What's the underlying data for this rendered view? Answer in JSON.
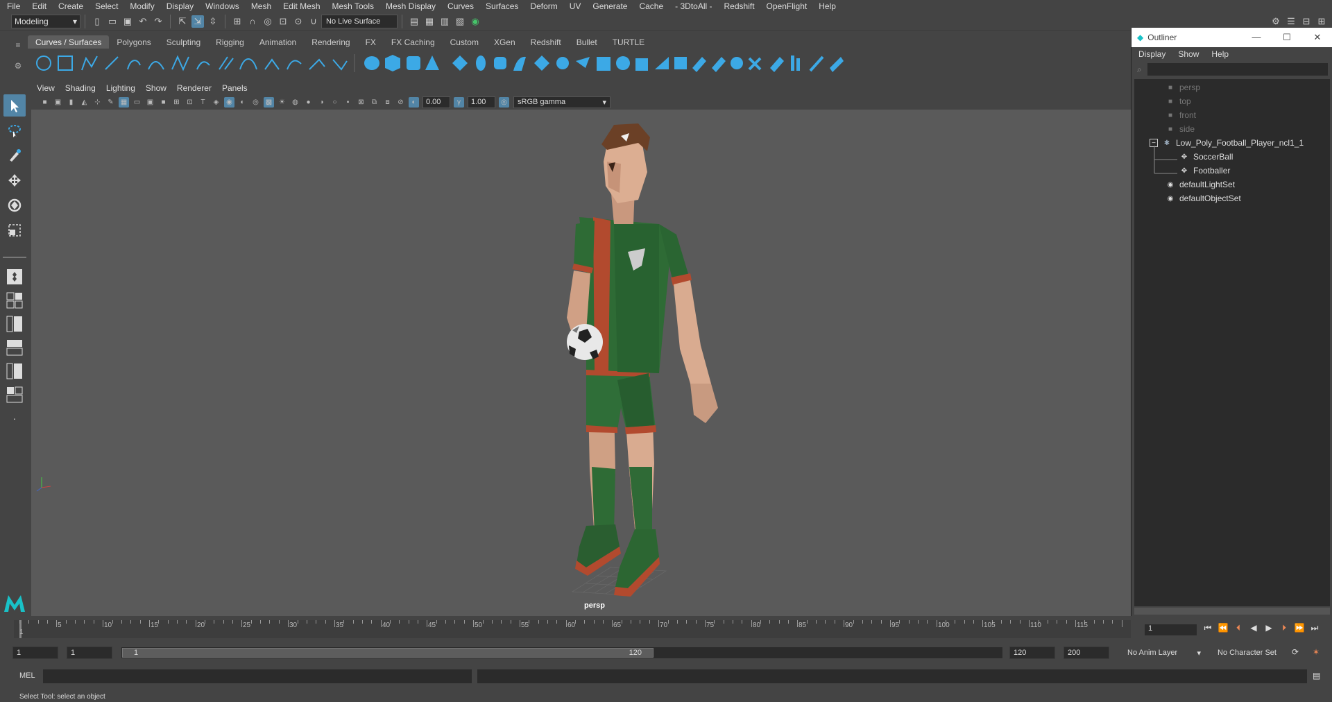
{
  "menubar": [
    "File",
    "Edit",
    "Create",
    "Select",
    "Modify",
    "Display",
    "Windows",
    "Mesh",
    "Edit Mesh",
    "Mesh Tools",
    "Mesh Display",
    "Curves",
    "Surfaces",
    "Deform",
    "UV",
    "Generate",
    "Cache",
    "- 3DtoAll -",
    "Redshift",
    "OpenFlight",
    "Help"
  ],
  "toolbar": {
    "mode": "Modeling",
    "live_surface": "No Live Surface"
  },
  "shelf_tabs": [
    "Curves / Surfaces",
    "Polygons",
    "Sculpting",
    "Rigging",
    "Animation",
    "Rendering",
    "FX",
    "FX Caching",
    "Custom",
    "XGen",
    "Redshift",
    "Bullet",
    "TURTLE"
  ],
  "panel_menu": [
    "View",
    "Shading",
    "Lighting",
    "Show",
    "Renderer",
    "Panels"
  ],
  "panel_tools": {
    "exposure": "0.00",
    "gamma": "1.00",
    "color_space": "sRGB gamma"
  },
  "viewport": {
    "camera": "persp"
  },
  "outliner": {
    "title": "Outliner",
    "menu": [
      "Display",
      "Show",
      "Help"
    ],
    "items": [
      {
        "label": "persp",
        "dim": true
      },
      {
        "label": "top",
        "dim": true
      },
      {
        "label": "front",
        "dim": true
      },
      {
        "label": "side",
        "dim": true
      },
      {
        "label": "Low_Poly_Football_Player_ncl1_1"
      },
      {
        "label": "SoccerBall"
      },
      {
        "label": "Footballer"
      },
      {
        "label": "defaultLightSet"
      },
      {
        "label": "defaultObjectSet"
      }
    ]
  },
  "timeline": {
    "ticks": [
      "5",
      "10",
      "15",
      "20",
      "25",
      "30",
      "35",
      "40",
      "45",
      "50",
      "55",
      "60",
      "65",
      "70",
      "75",
      "80",
      "85",
      "90",
      "95",
      "100",
      "105",
      "110",
      "115"
    ],
    "start_label": "1",
    "current_frame": "1"
  },
  "range": {
    "start": "1",
    "playback_start": "1",
    "slider_start": "1",
    "slider_end": "120",
    "playback_end": "120",
    "end": "200",
    "anim_layer": "No Anim Layer",
    "character_set": "No Character Set"
  },
  "cmdline": {
    "label": "MEL"
  },
  "help_line": "Select Tool: select an object",
  "colors": {
    "accent": "#5285a6",
    "jersey_green": "#2e6b35",
    "jersey_red": "#b24a2e",
    "skin": "#d2a48a",
    "hair": "#6b4026",
    "viewport_bg": "#5a5a5a"
  }
}
